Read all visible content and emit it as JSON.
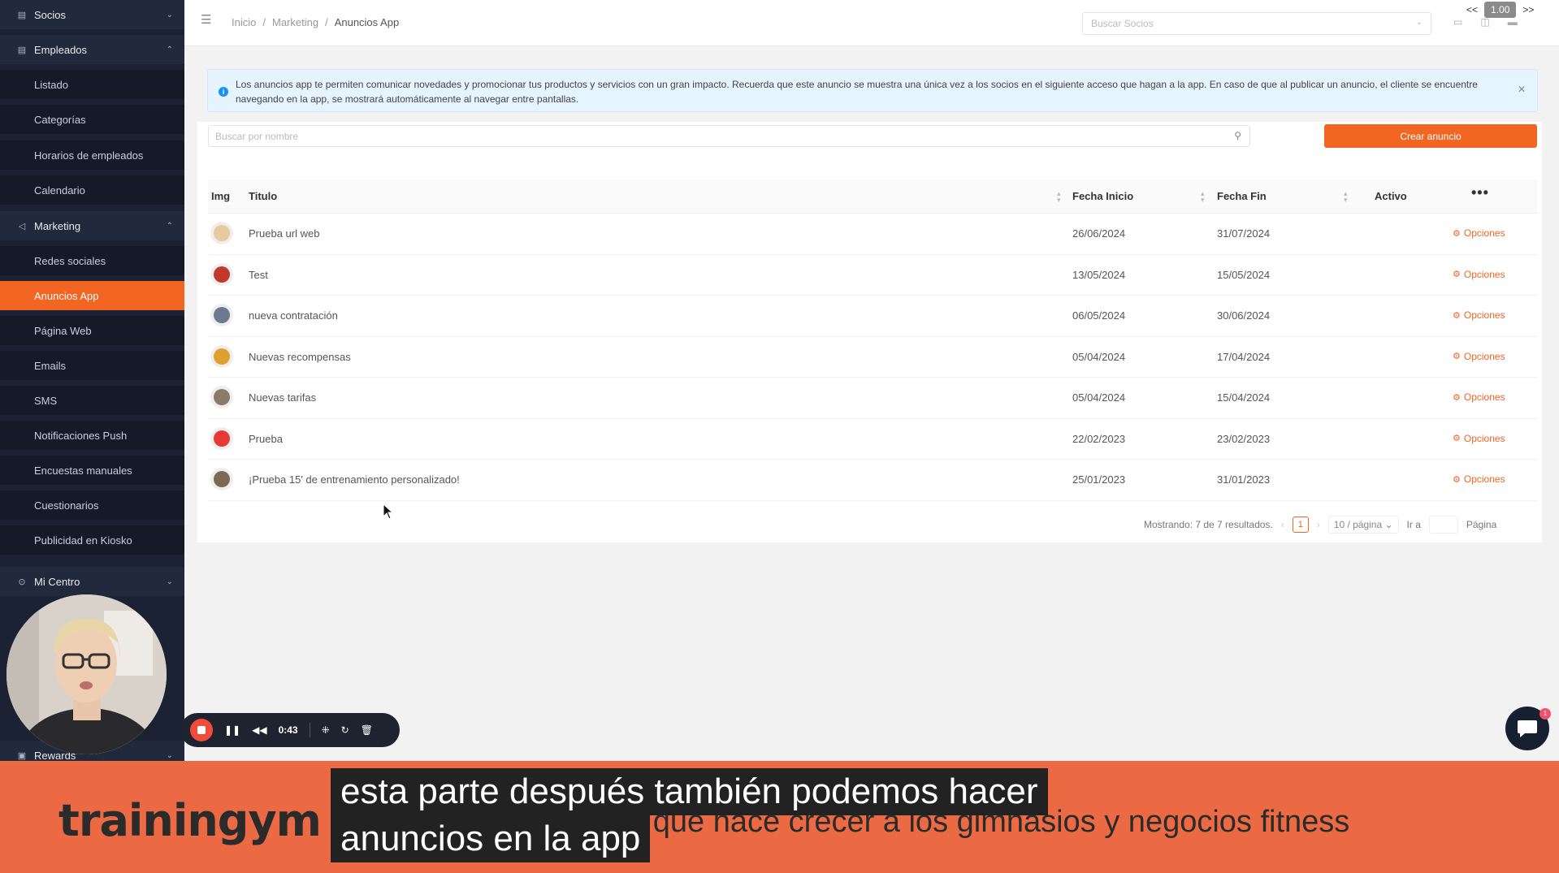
{
  "sidebar": {
    "items": [
      {
        "label": "Socios",
        "type": "group",
        "icon": "id-card-icon",
        "chevron": "⌄"
      },
      {
        "label": "Empleados",
        "type": "group",
        "icon": "id-card-icon",
        "chevron": "⌃"
      },
      {
        "label": "Listado",
        "type": "sub"
      },
      {
        "label": "Categorías",
        "type": "sub"
      },
      {
        "label": "Horarios de empleados",
        "type": "sub"
      },
      {
        "label": "Calendario",
        "type": "sub"
      },
      {
        "label": "Marketing",
        "type": "group",
        "icon": "megaphone-icon",
        "chevron": "⌃"
      },
      {
        "label": "Redes sociales",
        "type": "sub"
      },
      {
        "label": "Anuncios App",
        "type": "sub",
        "active": true
      },
      {
        "label": "Página Web",
        "type": "sub"
      },
      {
        "label": "Emails",
        "type": "sub"
      },
      {
        "label": "SMS",
        "type": "sub"
      },
      {
        "label": "Notificaciones Push",
        "type": "sub"
      },
      {
        "label": "Encuestas manuales",
        "type": "sub"
      },
      {
        "label": "Cuestionarios",
        "type": "sub"
      },
      {
        "label": "Publicidad en Kiosko",
        "type": "sub"
      },
      {
        "label": "Mi Centro",
        "type": "group",
        "icon": "location-pin-icon",
        "chevron": "⌄"
      },
      {
        "label": "Rewards",
        "type": "group",
        "icon": "gift-icon",
        "chevron": "⌄"
      }
    ]
  },
  "header": {
    "breadcrumb": [
      "Inicio",
      "Marketing",
      "Anuncios App"
    ],
    "search_placeholder": "Buscar Socios",
    "playback": {
      "prev": "<<",
      "speed": "1.00",
      "next": ">>"
    }
  },
  "alert": {
    "text": "Los anuncios app te permiten comunicar novedades y promocionar tus productos y servicios con un gran impacto. Recuerda que este anuncio se muestra una única vez a los socios en el siguiente acceso que hagan a la app. En caso de que al publicar un anuncio, el cliente se encuentre navegando en la app, se mostrará automáticamente al navegar entre pantallas."
  },
  "toolbar": {
    "search_placeholder": "Buscar por nombre",
    "create_label": "Crear anuncio"
  },
  "table": {
    "headers": {
      "img": "Img",
      "titulo": "Titulo",
      "inicio": "Fecha Inicio",
      "fin": "Fecha Fin",
      "activo": "Activo",
      "more": "•••"
    },
    "rows": [
      {
        "titulo": "Prueba url web",
        "inicio": "26/06/2024",
        "fin": "31/07/2024",
        "opciones": "Opciones",
        "avatar_color": "#e8c9a0"
      },
      {
        "titulo": "Test",
        "inicio": "13/05/2024",
        "fin": "15/05/2024",
        "opciones": "Opciones",
        "avatar_color": "#c0392b"
      },
      {
        "titulo": "nueva contratación",
        "inicio": "06/05/2024",
        "fin": "30/06/2024",
        "opciones": "Opciones",
        "avatar_color": "#6b7a8f"
      },
      {
        "titulo": "Nuevas recompensas",
        "inicio": "05/04/2024",
        "fin": "17/04/2024",
        "opciones": "Opciones",
        "avatar_color": "#e0a030"
      },
      {
        "titulo": "Nuevas tarifas",
        "inicio": "05/04/2024",
        "fin": "15/04/2024",
        "opciones": "Opciones",
        "avatar_color": "#8a7a6a"
      },
      {
        "titulo": "Prueba",
        "inicio": "22/02/2023",
        "fin": "23/02/2023",
        "opciones": "Opciones",
        "avatar_color": "#e53935"
      },
      {
        "titulo": "¡Prueba 15' de entrenamiento personalizado!",
        "inicio": "25/01/2023",
        "fin": "31/01/2023",
        "opciones": "Opciones",
        "avatar_color": "#7a6a55"
      }
    ]
  },
  "pagination": {
    "summary": "Mostrando: 7 de 7 resultados.",
    "page": "1",
    "page_size": "10 / página",
    "goto_label": "Ir a",
    "page_label": "Página"
  },
  "recorder": {
    "time": "0:43"
  },
  "chat": {
    "badge": "1"
  },
  "banner": {
    "brand": "trainingym",
    "tagline": "La tecnología que hace crecer a los gimnasios y negocios fitness",
    "subtitle_line1": "esta parte después también podemos hacer",
    "subtitle_line2": "anuncios en la app"
  },
  "colors": {
    "accent": "#f26522",
    "sidebar_bg": "#1b2233",
    "banner_bg": "#ec6a43",
    "info": "#1890ff"
  }
}
